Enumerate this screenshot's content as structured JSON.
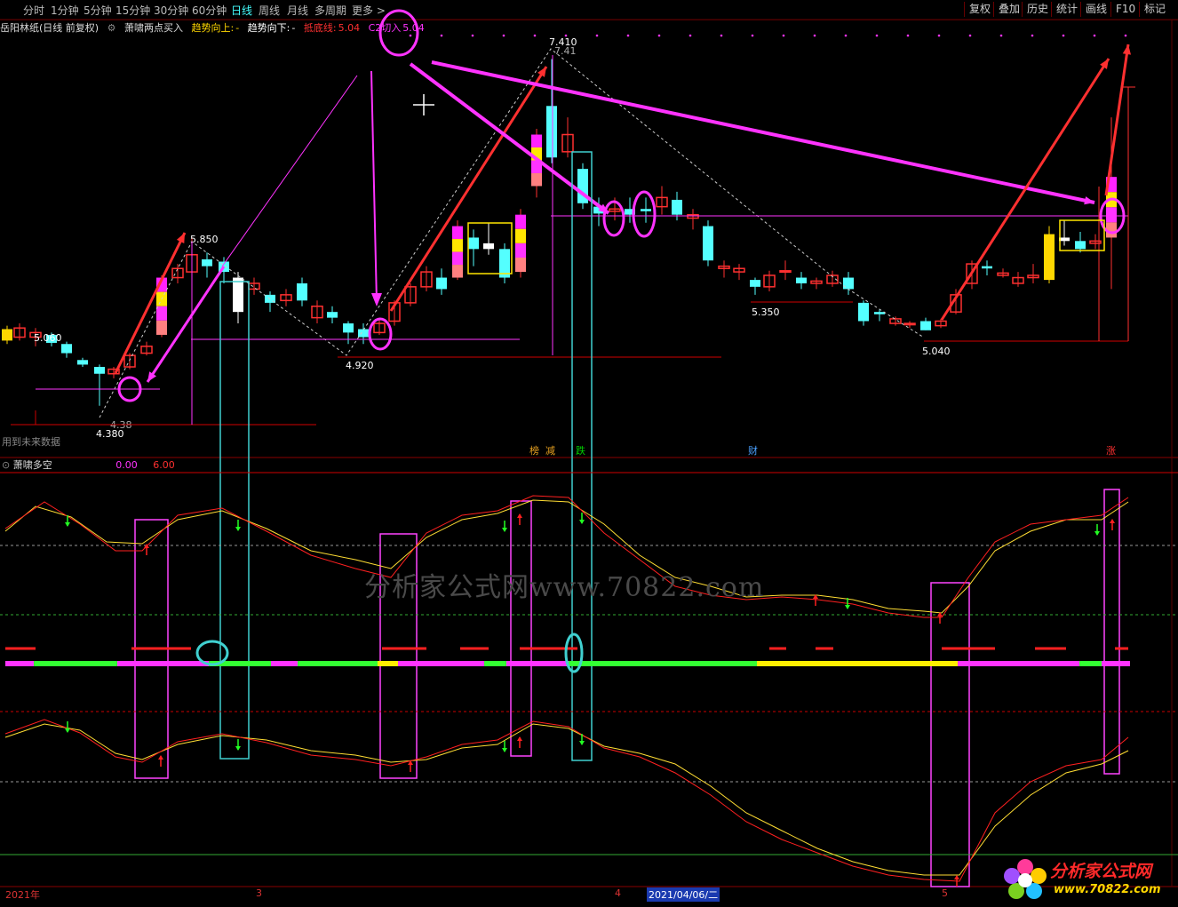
{
  "toolbar": {
    "tabs": [
      "分时",
      "1分钟",
      "5分钟",
      "15分钟",
      "30分钟",
      "60分钟",
      "日线",
      "周线",
      "月线",
      "多周期",
      "更多 >"
    ],
    "active_tab": "日线",
    "right_buttons": [
      "复权",
      "叠加",
      "历史",
      "统计",
      "画线",
      "F10",
      "标记"
    ]
  },
  "info": {
    "stock": "岳阳林纸(日线 前复权)",
    "indicator": "萧啸两点买入",
    "trend_up": "趋势向上:",
    "trend_up_val": "-",
    "trend_down": "趋势向下:",
    "trend_down_val": "-",
    "support_label": "抵底线:",
    "support_val": "5.04",
    "c2_label": "C2切入",
    "c2_val": "5.04"
  },
  "price_labels": {
    "p1": "5.060",
    "p2": "4.380",
    "p2b": "4.38",
    "p3": "5.850",
    "p4": "4.920",
    "p5": "7.410",
    "p5b": "7.41",
    "p6": "5.350",
    "p7": "5.040"
  },
  "future_data": "用到未来数据",
  "event_tags": [
    {
      "text": "榜",
      "color": "#e6a020"
    },
    {
      "text": "减",
      "color": "#e6a020"
    },
    {
      "text": "跌",
      "color": "#00d000"
    },
    {
      "text": "财",
      "color": "#4aa0ff"
    },
    {
      "text": "涨",
      "color": "#ff3030"
    }
  ],
  "panel2": {
    "title": "萧啸多空",
    "v1": "0.00",
    "v2": "6.00"
  },
  "dates": {
    "year": "2021年",
    "m3": "3",
    "m4": "4",
    "sel": "2021/04/06/二",
    "m5": "5"
  },
  "watermark": "分析家公式网www.70822.com",
  "logo": {
    "name": "分析家公式网",
    "url": "www.70822.com"
  },
  "colors": {
    "up": "#ff3030",
    "down": "#54ffff",
    "bg": "#000000",
    "magenta": "#ff33ff"
  }
}
